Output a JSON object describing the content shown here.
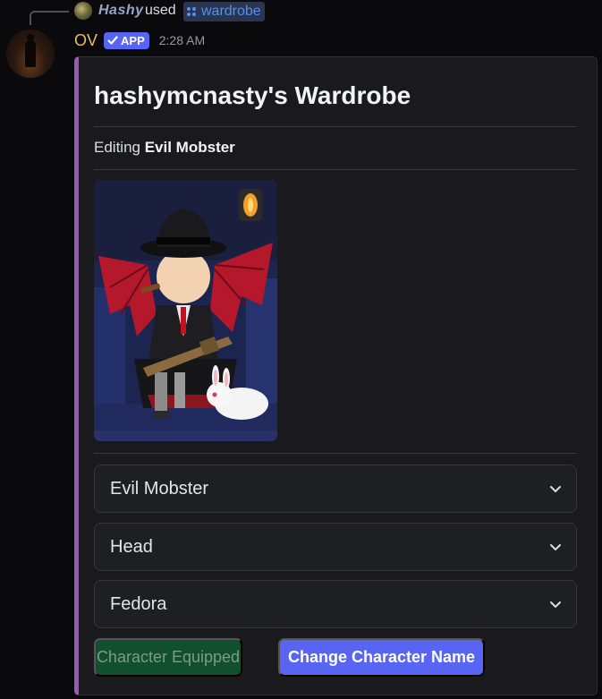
{
  "reply": {
    "user": "Hashy",
    "used_text": "used",
    "command": "wardrobe"
  },
  "message": {
    "author": "OV",
    "badge": "APP",
    "timestamp": "2:28 AM"
  },
  "embed": {
    "accent_color": "#9b59b6",
    "title": "hashymcnasty's Wardrobe",
    "subtitle_prefix": "Editing",
    "subtitle_bold": "Evil Mobster",
    "image_subject": "Evil Mobster character art"
  },
  "selects": [
    {
      "value": "Evil Mobster"
    },
    {
      "value": "Head"
    },
    {
      "value": "Fedora"
    }
  ],
  "buttons": {
    "equipped": "Character Equipped",
    "rename": "Change Character Name"
  }
}
